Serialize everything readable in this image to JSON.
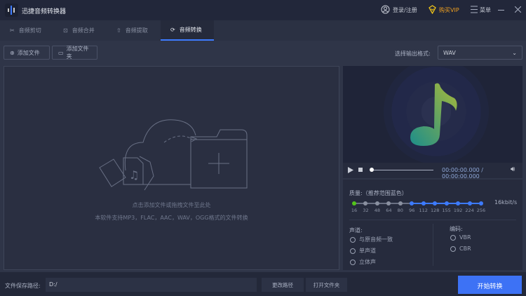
{
  "app": {
    "title": "迅捷音频转换器"
  },
  "header": {
    "login": "登录/注册",
    "vip": "购买VIP",
    "menu": "菜单",
    "vip_color": "#f0c419"
  },
  "tabs": [
    {
      "label": "音频剪切"
    },
    {
      "label": "音频合并"
    },
    {
      "label": "音频提取"
    },
    {
      "label": "音频转换"
    }
  ],
  "toolbar": {
    "add_file": "添加文件",
    "add_folder": "添加文件夹",
    "format_label": "选择输出格式:",
    "format_value": "WAV"
  },
  "dropzone": {
    "hint": "点击添加文件或拖拽文件至此处",
    "support": "本软件支持MP3，FLAC，AAC，WAV，OGG格式的文件转换"
  },
  "player": {
    "current": "00:00:00.000",
    "separator": " / ",
    "total": "00:00:00.000",
    "progress": 0
  },
  "quality": {
    "label": "质量:（推荐范围蓝色）",
    "values": [
      "16",
      "32",
      "48",
      "64",
      "80",
      "96",
      "112",
      "128",
      "155",
      "192",
      "224",
      "256"
    ],
    "selected_index": 0,
    "readout": "16kbit/s",
    "accent": "#3d7bff"
  },
  "channel": {
    "label": "声道:",
    "options": [
      "与原音频一致",
      "单声道",
      "立体声"
    ]
  },
  "encoding": {
    "label": "编码:",
    "options": [
      "VBR",
      "CBR"
    ]
  },
  "bottom": {
    "path_label": "文件保存路径:",
    "path_value": "D:/",
    "change_path": "更改路径",
    "open_folder": "打开文件夹",
    "start": "开始转换"
  }
}
